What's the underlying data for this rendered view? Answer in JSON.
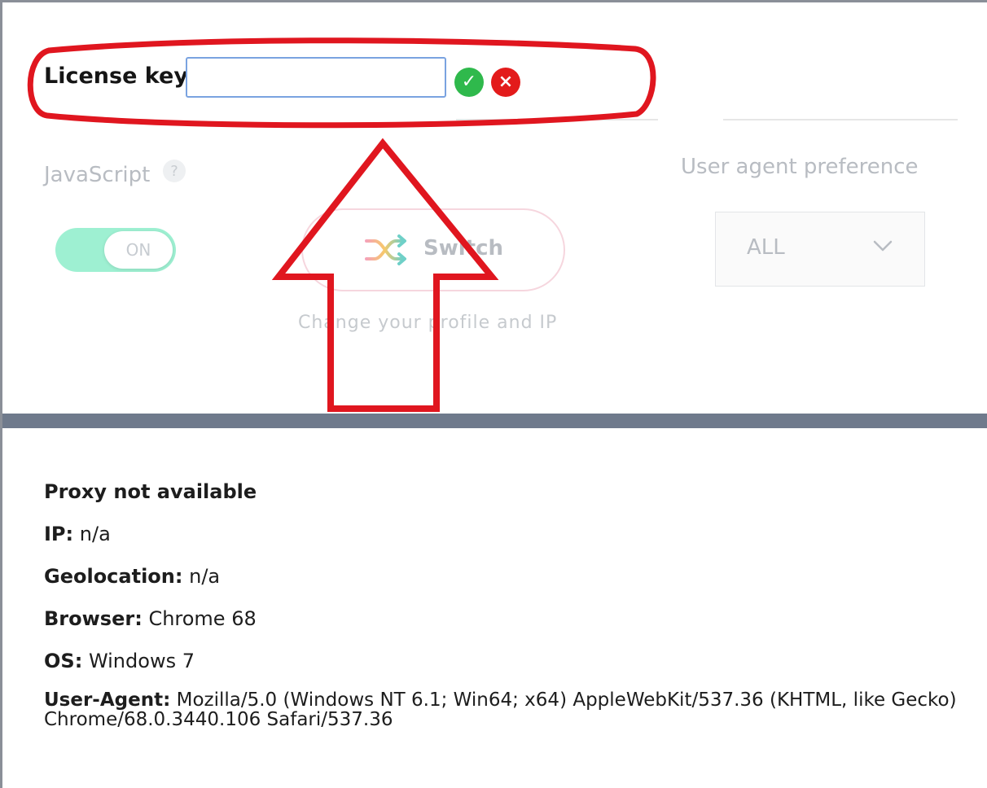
{
  "license": {
    "label": "License key:",
    "input_value": "",
    "confirm_icon": "check-circle-icon",
    "cancel_icon": "x-circle-icon",
    "confirm_color": "#2fb94c",
    "cancel_color": "#e31b1b"
  },
  "settings": {
    "javascript_label": "JavaScript",
    "help_glyph": "?",
    "toggle_state": "ON",
    "toggle_color": "#9ef0d2",
    "switch_label": "Switch",
    "switch_caption": "Change your profile and IP",
    "user_agent_label": "User agent preference",
    "user_agent_value": "ALL"
  },
  "proxy_info": {
    "status": "Proxy not available",
    "ip_label": "IP:",
    "ip_value": "n/a",
    "geo_label": "Geolocation:",
    "geo_value": "n/a",
    "browser_label": "Browser:",
    "browser_value": "Chrome 68",
    "os_label": "OS:",
    "os_value": "Windows 7",
    "ua_label": "User-Agent:",
    "ua_value": "Mozilla/5.0 (Windows NT 6.1; Win64; x64) AppleWebKit/537.36 (KHTML, like Gecko) Chrome/68.0.3440.106 Safari/537.36"
  },
  "annotation": {
    "color": "#e0161f",
    "shapes": [
      "highlight-ellipse",
      "up-arrow"
    ]
  }
}
